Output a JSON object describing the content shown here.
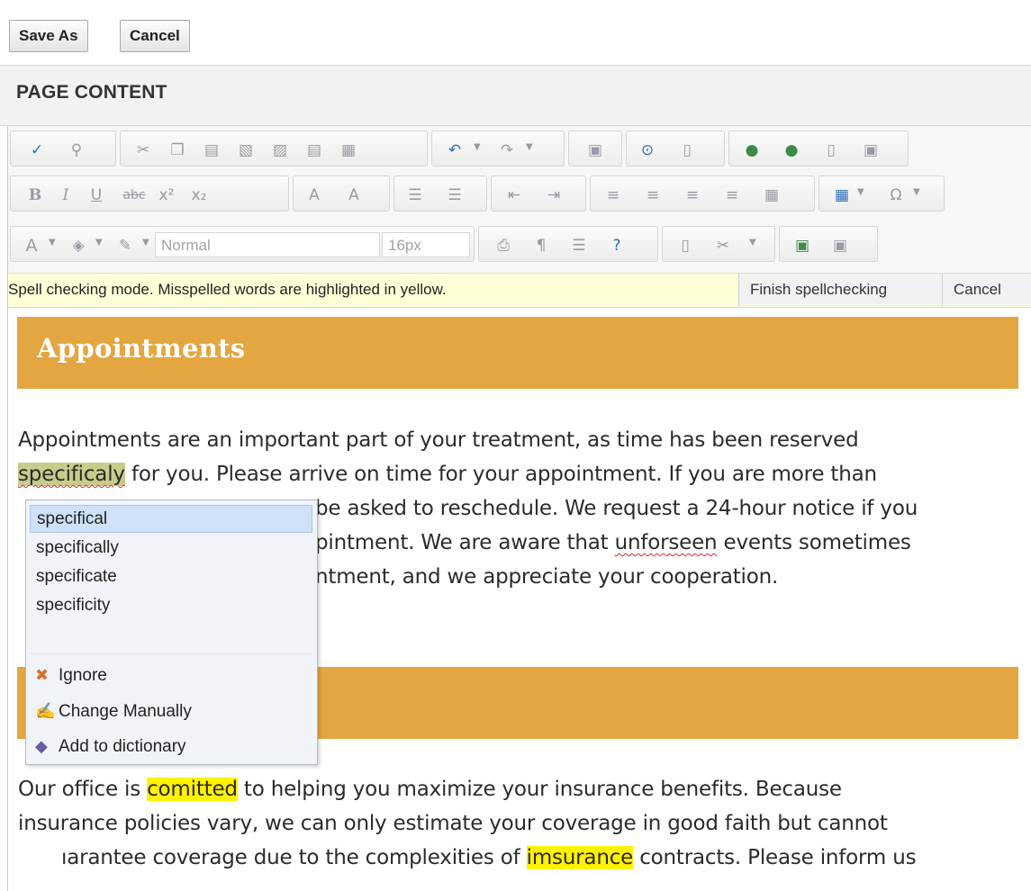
{
  "top_buttons": {
    "save_as": "Save As",
    "cancel": "Cancel"
  },
  "section_title": "PAGE CONTENT",
  "toolbar": {
    "format_placeholder": "Normal",
    "font_size_placeholder": "16px",
    "icons": [
      "spellcheck-icon",
      "find-icon",
      "cut-icon",
      "copy-icon",
      "paste-icon",
      "paste-word-icon",
      "paste-html-icon",
      "paste-plain-icon",
      "paste-as-icon",
      "undo-icon",
      "redo-icon",
      "image-icon",
      "media-icon",
      "document-icon",
      "link-icon",
      "unlink-icon",
      "anchor-icon",
      "image-map-icon",
      "bold-icon",
      "italic-icon",
      "underline-icon",
      "strikethrough-icon",
      "superscript-icon",
      "subscript-icon",
      "convert-lower-icon",
      "convert-upper-icon",
      "numbered-list-icon",
      "bulleted-list-icon",
      "outdent-icon",
      "indent-icon",
      "align-left-icon",
      "align-center-icon",
      "align-right-icon",
      "justify-icon",
      "clear-format-icon",
      "table-icon",
      "symbol-icon",
      "font-color-icon",
      "highlight-color-icon",
      "format-brush-icon",
      "print-icon",
      "paragraph-mark-icon",
      "line-spacing-icon",
      "help-icon",
      "template-icon",
      "snippet-icon",
      "insert-icon",
      "gallery-icon"
    ]
  },
  "spellcheck": {
    "message": "Spell checking mode. Misspelled words are highlighted in yellow.",
    "finish": "Finish spellchecking",
    "cancel": "Cancel"
  },
  "content": {
    "heading1": "Appointments",
    "para1": {
      "line1": "Appointments are an important part of your treatment, as time has been reserved",
      "line2_misspelled": "specificaly",
      "line2_rest": " for you. Please arrive on time for your appointment. If you are more than",
      "line3": "be asked to reschedule. We request a 24-hour notice if you",
      "line4_start": "pintment. We are aware that ",
      "line4_misspelled": "unforseen",
      "line4_end": " events sometimes",
      "line5": "ntment, and we appreciate your cooperation."
    },
    "para2": {
      "line1_start": "Our office is ",
      "line1_misspelled": "comitted",
      "line1_end": " to helping you maximize your insurance benefits. Because",
      "line2": "insurance policies vary, we can only estimate your coverage in good faith but cannot",
      "line3_start": "ıarantee coverage due to the complexities of ",
      "line3_misspelled": "imsurance",
      "line3_end": " contracts. Please inform us"
    }
  },
  "suggestion_menu": {
    "suggestions": [
      "specifical",
      "specifically",
      "specificate",
      "specificity"
    ],
    "ignore": "Ignore",
    "change_manually": "Change Manually",
    "add_to_dictionary": "Add to dictionary"
  },
  "colors": {
    "band": "#e4a640",
    "spellbar": "#ffffd8",
    "highlight": "#fff200",
    "menu_bg": "#f0f4f9"
  }
}
